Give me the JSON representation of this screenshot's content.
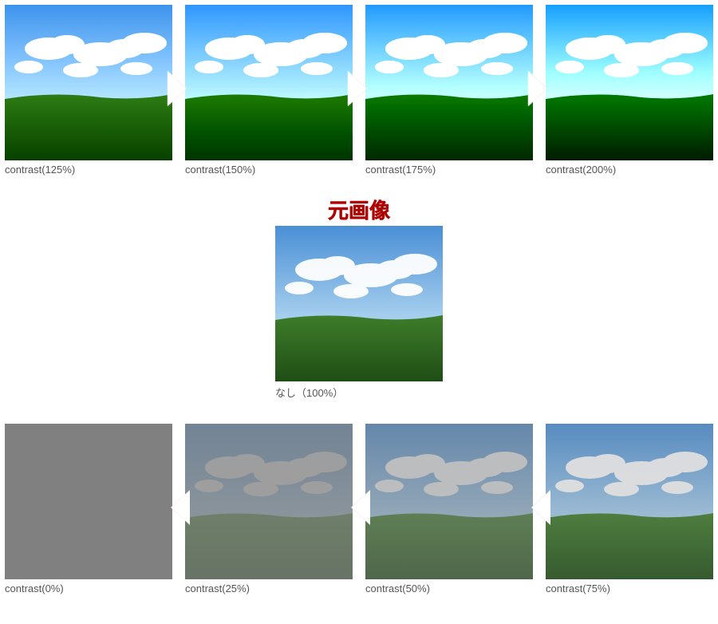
{
  "row_increase": {
    "direction": "right",
    "items": [
      {
        "label": "contrast(125%)",
        "contrast": 125
      },
      {
        "label": "contrast(150%)",
        "contrast": 150
      },
      {
        "label": "contrast(175%)",
        "contrast": 175
      },
      {
        "label": "contrast(200%)",
        "contrast": 200
      }
    ]
  },
  "original": {
    "heading": "元画像",
    "label": "なし（100%）",
    "contrast": 100
  },
  "row_decrease": {
    "direction": "left",
    "items": [
      {
        "label": "contrast(0%)",
        "contrast": 0
      },
      {
        "label": "contrast(25%)",
        "contrast": 25
      },
      {
        "label": "contrast(50%)",
        "contrast": 50
      },
      {
        "label": "contrast(75%)",
        "contrast": 75
      }
    ]
  }
}
